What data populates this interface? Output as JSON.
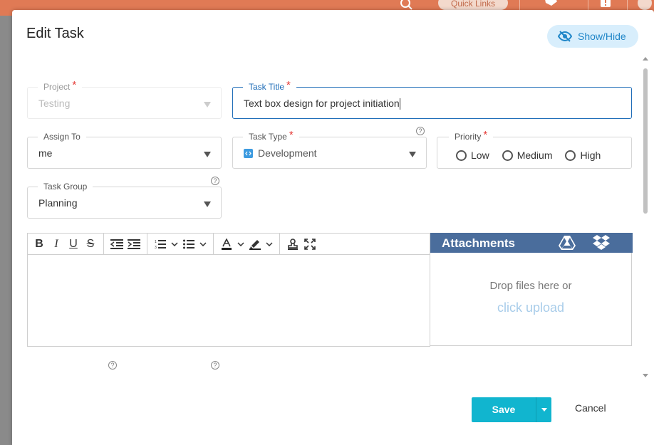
{
  "appbar": {
    "quick_links_label": "Quick Links",
    "icons": [
      "search-icon",
      "hand-icon",
      "alert-icon",
      "help-icon"
    ],
    "accent_color": "#e07a55"
  },
  "modal": {
    "title": "Edit Task",
    "show_hide_label": "Show/Hide"
  },
  "fields": {
    "project": {
      "label": "Project",
      "required": true,
      "value": "Testing",
      "disabled": true
    },
    "task_title": {
      "label": "Task Title",
      "required": true,
      "value": "Text box design for project initiation",
      "focused": true
    },
    "assign_to": {
      "label": "Assign To",
      "value": "me"
    },
    "task_type": {
      "label": "Task Type",
      "required": true,
      "value": "Development",
      "icon": "code-icon"
    },
    "priority": {
      "label": "Priority",
      "required": true,
      "options": [
        "Low",
        "Medium",
        "High"
      ],
      "selected": null
    },
    "task_group": {
      "label": "Task Group",
      "value": "Planning"
    }
  },
  "editor": {
    "toolbar_icons": [
      "bold-icon",
      "italic-icon",
      "underline-icon",
      "strikethrough-icon",
      "outdent-icon",
      "indent-icon",
      "ordered-list-icon",
      "unordered-list-icon",
      "font-color-icon",
      "highlight-icon",
      "clear-format-icon",
      "fullscreen-icon"
    ],
    "content": ""
  },
  "attachments": {
    "title": "Attachments",
    "drop_text": "Drop files here or",
    "upload_link": "click upload",
    "header_color": "#4a6d9c"
  },
  "footer": {
    "save_label": "Save",
    "cancel_label": "Cancel",
    "save_color": "#11b5cf"
  },
  "required_mark": "*",
  "help_mark": "?"
}
